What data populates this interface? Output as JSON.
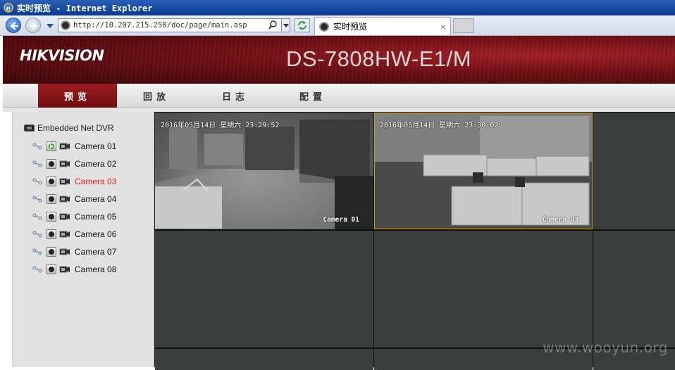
{
  "window": {
    "title": "实时预览 - Internet Explorer"
  },
  "browser": {
    "url": "http://10.207.215.250/doc/page/main.asp",
    "tab_title": "实时预览",
    "tab_close": "×"
  },
  "header": {
    "logo": "HIKVISION",
    "model": "DS-7808HW-E1/M"
  },
  "menu": {
    "items": [
      {
        "label": "预览",
        "active": true
      },
      {
        "label": "回放",
        "active": false
      },
      {
        "label": "日志",
        "active": false
      },
      {
        "label": "配置",
        "active": false
      }
    ]
  },
  "device_tree": {
    "root": "Embedded Net DVR",
    "cameras": [
      {
        "label": "Camera 01",
        "playing": true,
        "selected": false
      },
      {
        "label": "Camera 02",
        "playing": false,
        "selected": false
      },
      {
        "label": "Camera 03",
        "playing": false,
        "selected": true
      },
      {
        "label": "Camera 04",
        "playing": false,
        "selected": false
      },
      {
        "label": "Camera 05",
        "playing": false,
        "selected": false
      },
      {
        "label": "Camera 06",
        "playing": false,
        "selected": false
      },
      {
        "label": "Camera 07",
        "playing": false,
        "selected": false
      },
      {
        "label": "Camera 08",
        "playing": false,
        "selected": false
      }
    ]
  },
  "video": {
    "tiles": [
      {
        "timestamp": "2016年05月14日 星期六 23:29:52",
        "name": "Camera 01"
      },
      {
        "timestamp": "2016年05月14日 星期六 23:30:02",
        "name": "Camera 03"
      }
    ]
  },
  "watermark": "www.wooyun.org",
  "colors": {
    "title_bar": "#0b3a91",
    "banner_red": "#a32025",
    "menu_active": "#9b1c1e",
    "selected_camera": "#e21b1b",
    "tile_border_selected": "#d6a600",
    "empty_tile": "#3a3e3d"
  }
}
